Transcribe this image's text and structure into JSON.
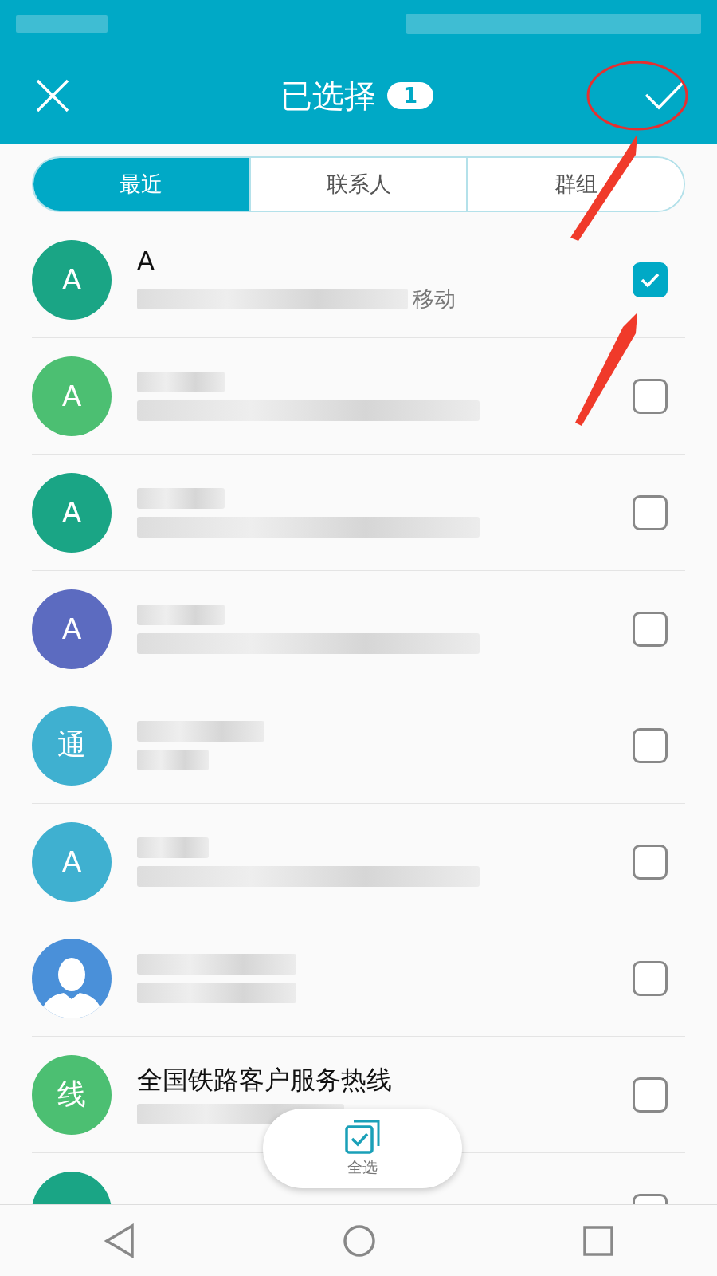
{
  "header": {
    "title": "已选择",
    "count": "1"
  },
  "tabs": [
    {
      "label": "最近",
      "selected": true
    },
    {
      "label": "联系人",
      "selected": false
    },
    {
      "label": "群组",
      "selected": false
    }
  ],
  "contacts": [
    {
      "avatar": "A",
      "kind": "letter",
      "color": "#1aa585",
      "name": "A",
      "detail": "移动",
      "checked": true
    },
    {
      "avatar": "A",
      "kind": "letter",
      "color": "#4cbf72",
      "checked": false
    },
    {
      "avatar": "A",
      "kind": "letter",
      "color": "#1aa585",
      "checked": false
    },
    {
      "avatar": "A",
      "kind": "letter",
      "color": "#5c6bc0",
      "checked": false
    },
    {
      "avatar": "通",
      "kind": "letter",
      "color": "#3fb0d0",
      "checked": false
    },
    {
      "avatar": "A",
      "kind": "letter",
      "color": "#3fb0d0",
      "checked": false
    },
    {
      "kind": "person",
      "color": "#4a90d9",
      "checked": false
    },
    {
      "avatar": "线",
      "kind": "letter",
      "color": "#4cbf72",
      "name": "全国铁路客户服务热线",
      "checked": false
    },
    {
      "kind": "partial",
      "color": "#1aa585",
      "checked": false
    }
  ],
  "select_all": {
    "label": "全选"
  }
}
